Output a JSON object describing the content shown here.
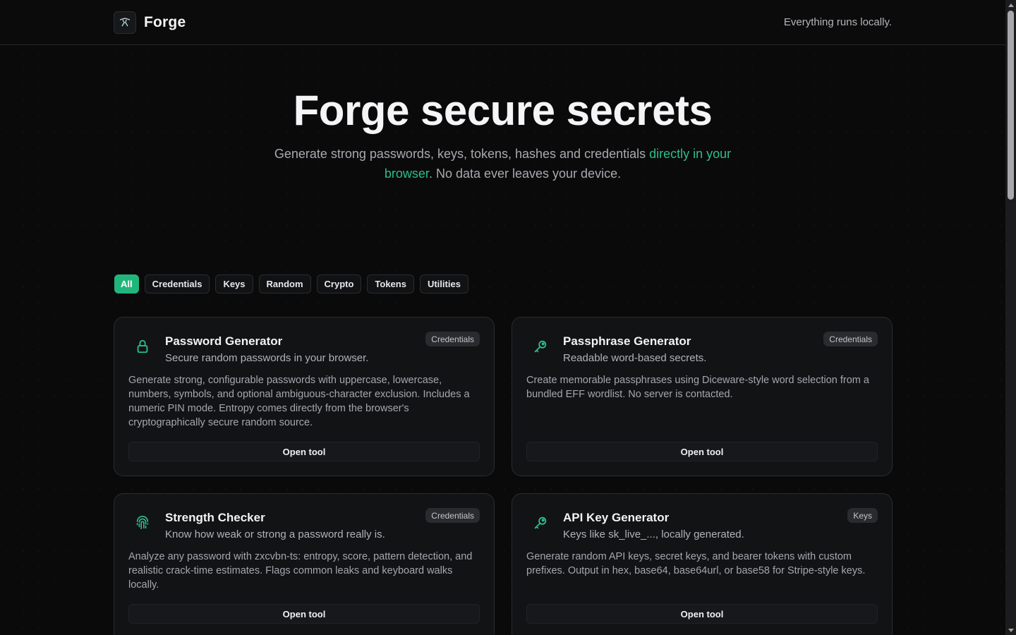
{
  "header": {
    "brand": "Forge",
    "tagline": "Everything runs locally."
  },
  "hero": {
    "title": "Forge secure secrets",
    "subtitle_before": "Generate strong passwords, keys, tokens, hashes and credentials ",
    "subtitle_accent": "directly in your browser",
    "subtitle_after": ". No data ever leaves your device."
  },
  "filters": [
    "All",
    "Credentials",
    "Keys",
    "Random",
    "Crypto",
    "Tokens",
    "Utilities"
  ],
  "active_filter": "All",
  "cards": [
    {
      "icon": "lock-icon",
      "title": "Password Generator",
      "subtitle": "Secure random passwords in your browser.",
      "badge": "Credentials",
      "description": "Generate strong, configurable passwords with uppercase, lowercase, numbers, symbols, and optional ambiguous-character exclusion. Includes a numeric PIN mode. Entropy comes directly from the browser's cryptographically secure random source.",
      "button": "Open tool"
    },
    {
      "icon": "key-icon",
      "title": "Passphrase Generator",
      "subtitle": "Readable word-based secrets.",
      "badge": "Credentials",
      "description": "Create memorable passphrases using Diceware-style word selection from a bundled EFF wordlist. No server is contacted.",
      "button": "Open tool"
    },
    {
      "icon": "fingerprint-icon",
      "title": "Strength Checker",
      "subtitle": "Know how weak or strong a password really is.",
      "badge": "Credentials",
      "description": "Analyze any password with zxcvbn-ts: entropy, score, pattern detection, and realistic crack-time estimates. Flags common leaks and keyboard walks locally.",
      "button": "Open tool"
    },
    {
      "icon": "key-icon",
      "title": "API Key Generator",
      "subtitle": "Keys like sk_live_..., locally generated.",
      "badge": "Keys",
      "description": "Generate random API keys, secret keys, and bearer tokens with custom prefixes. Output in hex, base64, base64url, or base58 for Stripe-style keys.",
      "button": "Open tool"
    }
  ],
  "colors": {
    "accent": "#21b57c",
    "accent_text": "#2bbf87",
    "background": "#0a0a0b",
    "card": "#121315"
  }
}
